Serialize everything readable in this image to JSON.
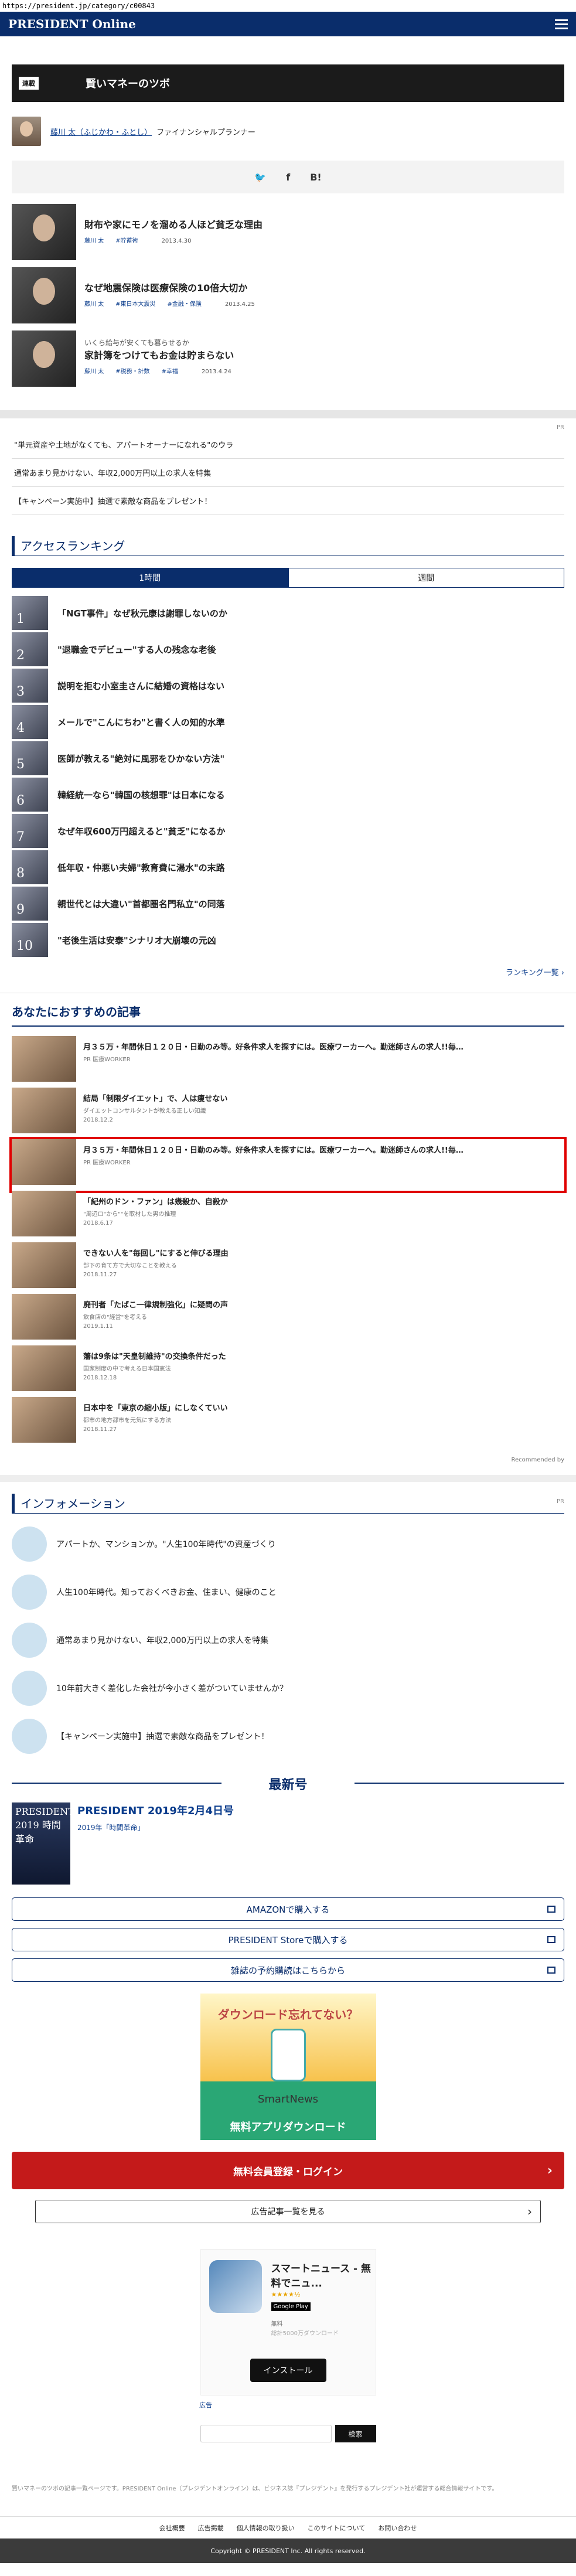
{
  "url": "https://president.jp/category/c00843",
  "header": {
    "logo": "PRESIDENT Online"
  },
  "series": {
    "tag": "連載",
    "title": "賢いマネーのツボ"
  },
  "author": {
    "name": "藤川 太（ふじかわ・ふとし）",
    "role": "ファイナンシャルプランナー"
  },
  "share": [
    "🐦",
    "f",
    "B!"
  ],
  "articles": [
    {
      "over": "",
      "title": "財布や家にモノを溜める人ほど貧乏な理由",
      "meta": "藤川 太　　#貯蓄術",
      "date": "2013.4.30"
    },
    {
      "over": "",
      "title": "なぜ地震保険は医療保険の10倍大切か",
      "meta": "藤川 太　　#東日本大震災　　#金融・保険",
      "date": "2013.4.25"
    },
    {
      "over": "いくら給与が安くても暮らせるか",
      "title": "家計簿をつけてもお金は貯まらない",
      "meta": "藤川 太　　#税務・計数　　#幸福",
      "date": "2013.4.24"
    }
  ],
  "pr": {
    "label": "PR",
    "items": [
      "\"単元資産や土地がなくても、アパートオーナーになれる\"のウラ",
      "通常あまり見かけない、年収2,000万円以上の求人を特集",
      "【キャンペーン実施中】抽選で素敵な商品をプレゼント！"
    ]
  },
  "ranking": {
    "title": "アクセスランキング",
    "tabs": [
      "1時間",
      "週間"
    ],
    "items": [
      {
        "n": "1",
        "t": "「NGT事件」なぜ秋元康は謝罪しないのか"
      },
      {
        "n": "2",
        "t": "\"退職金でデビュー\"する人の残念な老後"
      },
      {
        "n": "3",
        "t": "説明を拒む小室圭さんに結婚の資格はない"
      },
      {
        "n": "4",
        "t": "メールで\"こんにちわ\"と書く人の知的水準"
      },
      {
        "n": "5",
        "t": "医師が教える\"絶対に風邪をひかない方法\""
      },
      {
        "n": "6",
        "t": "韓経統一なら\"韓国の核想罪\"は日本になる"
      },
      {
        "n": "7",
        "t": "なぜ年収600万円超えると\"貧乏\"になるか"
      },
      {
        "n": "8",
        "t": "低年収・仲悪い夫婦\"教育費に湯水\"の末路"
      },
      {
        "n": "9",
        "t": "親世代とは大違い\"首都圏名門私立\"の同落"
      },
      {
        "n": "10",
        "t": "\"老後生活は安泰\"シナリオ大崩壊の元凶"
      }
    ],
    "more": "ランキング一覧 ›"
  },
  "recommend": {
    "title": "あなたにおすすめの記事",
    "items": [
      {
        "t": "月３５万・年間休日１２０日・日勤のみ等。好条件求人を探すには。医療ワーカーへ。勤迷師さんの求人!!毎…",
        "s": "PR 医療WORKER",
        "d": ""
      },
      {
        "t": "結局「制限ダイエット」で、人は痩せない",
        "s": "ダイエットコンサルタントが教える正しい知識",
        "d": "2018.12.2"
      },
      {
        "t": "月３５万・年間休日１２０日・日勤のみ等。好条件求人を探すには。医療ワーカーへ。勤迷師さんの求人!!毎…",
        "s": "PR 医療WORKER",
        "d": ""
      },
      {
        "t": "「紀州のドン・ファン」は幾殺か、自殺か",
        "s": "\"周辺ロ\"から\"\"を取材した男の推理",
        "d": "2018.6.17"
      },
      {
        "t": "できない人を\"毎回し\"にすると伸びる理由",
        "s": "部下の育て方で大切なことを教える",
        "d": "2018.11.27"
      },
      {
        "t": "廃刊者「たばこ一律規制強化」に疑問の声",
        "s": "飲食店の\"経営\"を考える",
        "d": "2019.1.11"
      },
      {
        "t": "藩は9条は\"天皇制維持\"の交換条件だった",
        "s": "国家制度の中で考える日本国憲法",
        "d": "2018.12.18"
      },
      {
        "t": "日本中を「東京の縮小版」にしなくていい",
        "s": "都市の地方都市を元気にする方法",
        "d": "2018.11.27"
      }
    ],
    "by": "Recommended by"
  },
  "info": {
    "title": "インフォメーション",
    "label": "PR",
    "items": [
      "アパートか、マンションか。\"人生100年時代\"の資産づくり",
      "人生100年時代。知っておくべきお金、住まい、健康のこと",
      "通常あまり見かけない、年収2,000万円以上の求人を特集",
      "10年前大きく差化した会社が今小さく差がついていませんか？",
      "【キャンペーン実施中】抽選で素敵な商品をプレゼント！"
    ]
  },
  "latest": {
    "title": "最新号",
    "cover": "PRESIDENT 2019 時間革命",
    "name": "PRESIDENT 2019年2月4日号",
    "sub": "2019年「時間革命」"
  },
  "buttons": [
    "AMAZONで購入する",
    "PRESIDENT Storeで購入する",
    "雑誌の予約購読はこちらから"
  ],
  "ad1": {
    "q": "ダウンロード忘れてない？",
    "brand": "SmartNews",
    "dl": "無料アプリダウンロード"
  },
  "register": "無料会員登録・ログイン",
  "adlist": "広告記事一覧を見る",
  "ad2": {
    "title": "スマートニュース - 無料でニュ...",
    "stars": "★★★★½",
    "gp": "Google Play",
    "free": "無料",
    "desc": "総計5000万ダウンロード",
    "install": "インストール"
  },
  "adtag": "広告",
  "search": {
    "btn": "検索"
  },
  "footnote": "賢いマネーのツボの記事一覧ページです。PRESIDENT Online（プレジデントオンライン）は、ビジネス誌『プレジデント』を発行するプレジデント社が運営する総合情報サイトです。",
  "footer": {
    "links": [
      "会社概要",
      "広告掲載",
      "個人情報の取り扱い",
      "このサイトについて",
      "お問い合わせ"
    ],
    "copy": "Copyright © PRESIDENT Inc. All rights reserved."
  }
}
